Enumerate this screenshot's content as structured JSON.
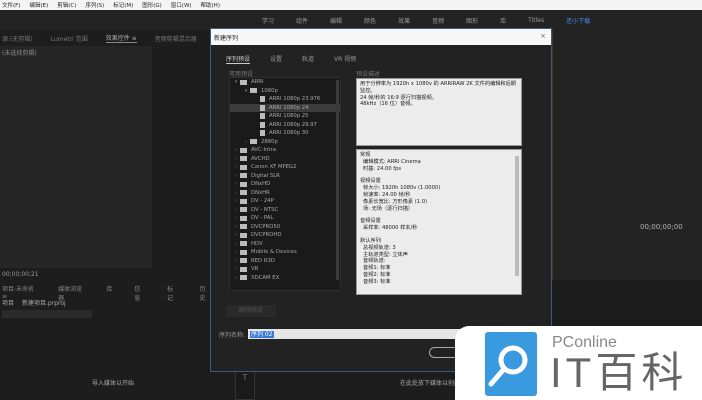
{
  "menu": [
    "文件(F)",
    "编辑(E)",
    "剪辑(C)",
    "序列(S)",
    "标记(M)",
    "图形(G)",
    "窗口(W)",
    "帮助(H)"
  ],
  "workspaces": [
    "学习",
    "组件",
    "编辑",
    "颜色",
    "效果",
    "音频",
    "图形",
    "库",
    "Titles",
    "还小下载"
  ],
  "workspace_active": 9,
  "source_tabs": [
    "源:(无剪辑)",
    "Lumetri 范围",
    "效果控件 ≡",
    "音频剪辑混合器"
  ],
  "clip_select": "(未选择剪辑)",
  "timecode_left": "00;00;00;21",
  "project_tabs": [
    "项目:未命名 ≡",
    "媒体浏览器",
    "库",
    "信息",
    "标记",
    "历史"
  ],
  "project_row": {
    "label": "项目",
    "file": "新建项目.prproj"
  },
  "import_hint": "导入媒体以开始",
  "drop_hint": "在此处放下媒体以创建序列",
  "timecode_right": "00;00;00;00",
  "dialog": {
    "title": "新建序列",
    "close": "×",
    "tabs": [
      "序列预设",
      "设置",
      "轨道",
      "VR 视频"
    ],
    "preset_label": "可用预设",
    "desc_label": "预设描述",
    "tree": [
      {
        "level": 0,
        "type": "folder",
        "open": true,
        "label": "ARRI"
      },
      {
        "level": 1,
        "type": "folder",
        "open": true,
        "label": "1080p"
      },
      {
        "level": 2,
        "type": "file",
        "label": "ARRI 1080p 23.976"
      },
      {
        "level": 2,
        "type": "file",
        "label": "ARRI 1080p 24",
        "selected": true
      },
      {
        "level": 2,
        "type": "file",
        "label": "ARRI 1080p 25"
      },
      {
        "level": 2,
        "type": "file",
        "label": "ARRI 1080p 29.97"
      },
      {
        "level": 2,
        "type": "file",
        "label": "ARRI 1080p 30"
      },
      {
        "level": 1,
        "type": "folder",
        "label": "2880p"
      },
      {
        "level": 0,
        "type": "folder",
        "label": "AVC-Intra"
      },
      {
        "level": 0,
        "type": "folder",
        "label": "AVCHD"
      },
      {
        "level": 0,
        "type": "folder",
        "label": "Canon XF MPEG2"
      },
      {
        "level": 0,
        "type": "folder",
        "label": "Digital SLR"
      },
      {
        "level": 0,
        "type": "folder",
        "label": "DNxHD"
      },
      {
        "level": 0,
        "type": "folder",
        "label": "DNxHR"
      },
      {
        "level": 0,
        "type": "folder",
        "label": "DV - 24P"
      },
      {
        "level": 0,
        "type": "folder",
        "label": "DV - NTSC"
      },
      {
        "level": 0,
        "type": "folder",
        "label": "DV - PAL"
      },
      {
        "level": 0,
        "type": "folder",
        "label": "DVCPRO50"
      },
      {
        "level": 0,
        "type": "folder",
        "label": "DVCPROHD"
      },
      {
        "level": 0,
        "type": "folder",
        "label": "HDV"
      },
      {
        "level": 0,
        "type": "folder",
        "label": "Mobile & Devices"
      },
      {
        "level": 0,
        "type": "folder",
        "label": "RED R3D"
      },
      {
        "level": 0,
        "type": "folder",
        "label": "VR"
      },
      {
        "level": 0,
        "type": "folder",
        "label": "XDCAM EX"
      }
    ],
    "description": [
      "用于分辨率为 1920h x 1080v 的 ARRIRAW 2K 文件的编辑和后期",
      "监控。",
      "24 帧/秒的 16:9 逐行扫描视频。",
      "48kHz（16 位）音频。"
    ],
    "details": {
      "general_title": "常规",
      "general": [
        "编辑模式: ARRI Cinema",
        "时基: 24.00 fps"
      ],
      "video_title": "视频设置",
      "video": [
        "帧大小: 1920h 1080v (1.0000)",
        "帧速率: 24.00 帧/秒",
        "像素长宽比: 方形像素 (1.0)",
        "场: 无场（逐行扫描）"
      ],
      "audio_title": "音频设置",
      "audio": [
        "采样率: 48000 样本/秒"
      ],
      "seq_title": "默认序列",
      "seq": [
        "总视频轨道: 3",
        "主轨道类型: 立体声",
        "音频轨道:",
        "音频1: 标准",
        "音频2: 标准",
        "音频3: 标准"
      ]
    },
    "delete_preset": "删除预设",
    "name_label": "序列名称:",
    "name_value": "序列 02"
  },
  "watermark": {
    "small": "PConline",
    "big": "IT百科",
    "color": "#3a9ae0"
  }
}
